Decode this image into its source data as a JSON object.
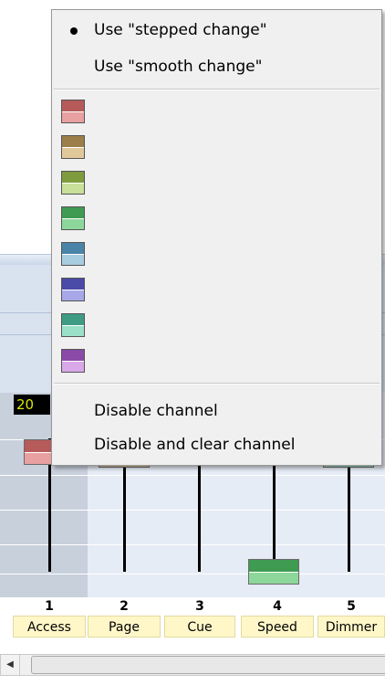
{
  "value_display": "20",
  "channels": [
    {
      "number": "1",
      "name": "Access"
    },
    {
      "number": "2",
      "name": "Page"
    },
    {
      "number": "3",
      "name": "Cue"
    },
    {
      "number": "4",
      "name": "Speed"
    },
    {
      "number": "5",
      "name": "Dimmer"
    }
  ],
  "faders": [
    {
      "level": 0.9,
      "top": "#b65a5a",
      "bottom": "#e8a0a0"
    },
    {
      "level": 0.88,
      "top": "#9c7e4a",
      "bottom": "#e0c89a"
    },
    {
      "level": null
    },
    {
      "level": 0.0,
      "top": "#3f9a52",
      "bottom": "#8ed79a"
    },
    {
      "level": 0.88,
      "top": "#4aa88a",
      "bottom": "#a0e0c8"
    }
  ],
  "menu": {
    "items_top": [
      {
        "label": "Use \"stepped change\"",
        "checked": true
      },
      {
        "label": "Use \"smooth change\"",
        "checked": false
      }
    ],
    "colors": [
      {
        "name": "red",
        "top": "#b65a5a",
        "bottom": "#e8a0a0"
      },
      {
        "name": "tan",
        "top": "#9c7e4a",
        "bottom": "#e0c89a"
      },
      {
        "name": "olive",
        "top": "#7e9c3e",
        "bottom": "#c8e09a"
      },
      {
        "name": "green",
        "top": "#3f9a52",
        "bottom": "#8ed79a"
      },
      {
        "name": "steel-blue",
        "top": "#4a84a8",
        "bottom": "#a8cce0"
      },
      {
        "name": "indigo",
        "top": "#4a4aa8",
        "bottom": "#a8a8e8"
      },
      {
        "name": "teal",
        "top": "#3e9c84",
        "bottom": "#9ae0c8"
      },
      {
        "name": "purple",
        "top": "#8a4aa8",
        "bottom": "#d8a8e8"
      }
    ],
    "items_bottom": [
      {
        "label": "Disable channel"
      },
      {
        "label": "Disable and clear channel"
      }
    ]
  }
}
